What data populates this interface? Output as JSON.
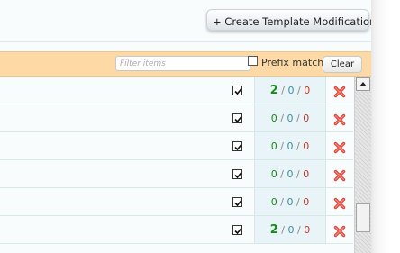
{
  "header": {
    "create_button_label": "+ Create Template Modification"
  },
  "filter": {
    "placeholder": "Filter items",
    "prefix_match_label": "Prefix match",
    "prefix_match_checked": false,
    "clear_label": "Clear"
  },
  "rows": [
    {
      "enabled": true,
      "count_a": "2",
      "sep1": "/",
      "count_b": "0",
      "sep2": "/",
      "count_c": "0",
      "highlight": true
    },
    {
      "enabled": true,
      "count_a": "0",
      "sep1": "/",
      "count_b": "0",
      "sep2": "/",
      "count_c": "0",
      "highlight": false
    },
    {
      "enabled": true,
      "count_a": "0",
      "sep1": "/",
      "count_b": "0",
      "sep2": "/",
      "count_c": "0",
      "highlight": false
    },
    {
      "enabled": true,
      "count_a": "0",
      "sep1": "/",
      "count_b": "0",
      "sep2": "/",
      "count_c": "0",
      "highlight": false
    },
    {
      "enabled": true,
      "count_a": "0",
      "sep1": "/",
      "count_b": "0",
      "sep2": "/",
      "count_c": "0",
      "highlight": false
    },
    {
      "enabled": true,
      "count_a": "2",
      "sep1": "/",
      "count_b": "0",
      "sep2": "/",
      "count_c": "0",
      "highlight": true
    }
  ],
  "icons": {
    "row_checkbox": "checkmark-icon",
    "row_delete": "delete-x-icon",
    "scroll_up": "arrow-up-icon"
  },
  "colors": {
    "filter_bar": "#fdd9a6",
    "count_green": "#1a8a1a",
    "count_blue": "#3a8fa0",
    "count_red": "#c0392b",
    "delete_red": "#e0453a"
  }
}
